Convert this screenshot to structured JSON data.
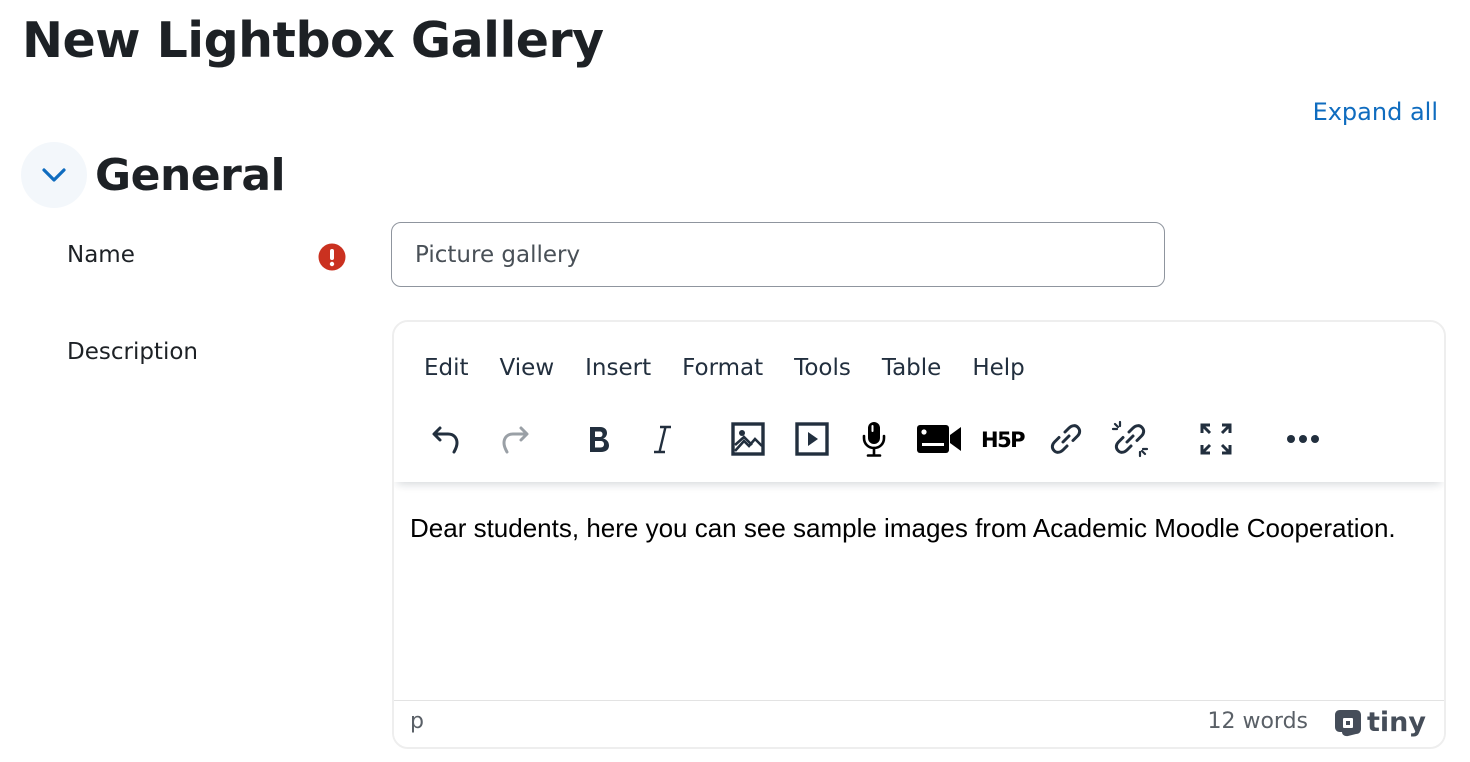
{
  "page": {
    "title": "New Lightbox Gallery",
    "expand_all_label": "Expand all"
  },
  "section": {
    "title": "General",
    "collapse_icon": "chevron-down-icon"
  },
  "colors": {
    "link": "#0f6cbf",
    "required": "#ca3120",
    "text": "#1d2125"
  },
  "form": {
    "name": {
      "label": "Name",
      "required_icon": "exclamation-circle-icon",
      "value": "Picture gallery"
    },
    "description": {
      "label": "Description",
      "editor": {
        "menubar": [
          "Edit",
          "View",
          "Insert",
          "Format",
          "Tools",
          "Table",
          "Help"
        ],
        "toolbar": [
          {
            "icon": "undo-icon",
            "label": "Undo"
          },
          {
            "icon": "redo-icon",
            "label": "Redo",
            "disabled": true
          },
          {
            "icon": "bold-icon",
            "label": "Bold"
          },
          {
            "icon": "italic-icon",
            "label": "Italic"
          },
          {
            "icon": "image-icon",
            "label": "Image"
          },
          {
            "icon": "media-icon",
            "label": "Multimedia"
          },
          {
            "icon": "microphone-icon",
            "label": "Record audio"
          },
          {
            "icon": "video-camera-icon",
            "label": "Record video"
          },
          {
            "icon": "h5p-icon",
            "label": "H5P"
          },
          {
            "icon": "link-icon",
            "label": "Link"
          },
          {
            "icon": "unlink-icon",
            "label": "Unlink"
          },
          {
            "icon": "fullscreen-icon",
            "label": "Full screen"
          },
          {
            "icon": "more-icon",
            "label": "More"
          }
        ],
        "content": "Dear students, here you can see sample images from Academic Moodle Cooperation.",
        "status_path": "p",
        "word_count": "12 words",
        "branding": "tiny"
      }
    }
  }
}
